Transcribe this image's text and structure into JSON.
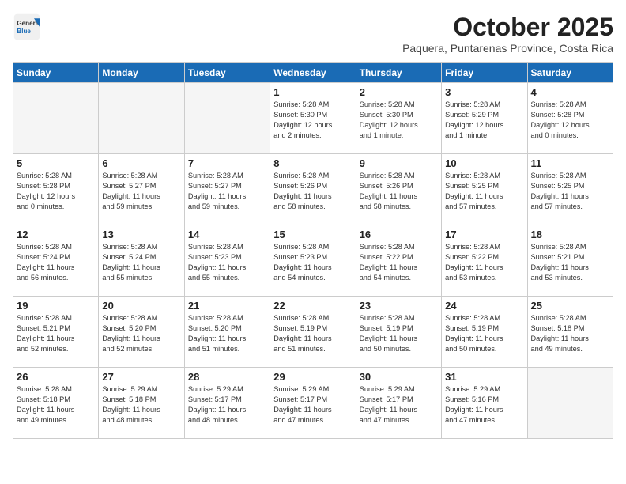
{
  "header": {
    "logo_general": "General",
    "logo_blue": "Blue",
    "month_title": "October 2025",
    "location": "Paquera, Puntarenas Province, Costa Rica"
  },
  "days_of_week": [
    "Sunday",
    "Monday",
    "Tuesday",
    "Wednesday",
    "Thursday",
    "Friday",
    "Saturday"
  ],
  "weeks": [
    [
      {
        "day": "",
        "info": ""
      },
      {
        "day": "",
        "info": ""
      },
      {
        "day": "",
        "info": ""
      },
      {
        "day": "1",
        "info": "Sunrise: 5:28 AM\nSunset: 5:30 PM\nDaylight: 12 hours\nand 2 minutes."
      },
      {
        "day": "2",
        "info": "Sunrise: 5:28 AM\nSunset: 5:30 PM\nDaylight: 12 hours\nand 1 minute."
      },
      {
        "day": "3",
        "info": "Sunrise: 5:28 AM\nSunset: 5:29 PM\nDaylight: 12 hours\nand 1 minute."
      },
      {
        "day": "4",
        "info": "Sunrise: 5:28 AM\nSunset: 5:28 PM\nDaylight: 12 hours\nand 0 minutes."
      }
    ],
    [
      {
        "day": "5",
        "info": "Sunrise: 5:28 AM\nSunset: 5:28 PM\nDaylight: 12 hours\nand 0 minutes."
      },
      {
        "day": "6",
        "info": "Sunrise: 5:28 AM\nSunset: 5:27 PM\nDaylight: 11 hours\nand 59 minutes."
      },
      {
        "day": "7",
        "info": "Sunrise: 5:28 AM\nSunset: 5:27 PM\nDaylight: 11 hours\nand 59 minutes."
      },
      {
        "day": "8",
        "info": "Sunrise: 5:28 AM\nSunset: 5:26 PM\nDaylight: 11 hours\nand 58 minutes."
      },
      {
        "day": "9",
        "info": "Sunrise: 5:28 AM\nSunset: 5:26 PM\nDaylight: 11 hours\nand 58 minutes."
      },
      {
        "day": "10",
        "info": "Sunrise: 5:28 AM\nSunset: 5:25 PM\nDaylight: 11 hours\nand 57 minutes."
      },
      {
        "day": "11",
        "info": "Sunrise: 5:28 AM\nSunset: 5:25 PM\nDaylight: 11 hours\nand 57 minutes."
      }
    ],
    [
      {
        "day": "12",
        "info": "Sunrise: 5:28 AM\nSunset: 5:24 PM\nDaylight: 11 hours\nand 56 minutes."
      },
      {
        "day": "13",
        "info": "Sunrise: 5:28 AM\nSunset: 5:24 PM\nDaylight: 11 hours\nand 55 minutes."
      },
      {
        "day": "14",
        "info": "Sunrise: 5:28 AM\nSunset: 5:23 PM\nDaylight: 11 hours\nand 55 minutes."
      },
      {
        "day": "15",
        "info": "Sunrise: 5:28 AM\nSunset: 5:23 PM\nDaylight: 11 hours\nand 54 minutes."
      },
      {
        "day": "16",
        "info": "Sunrise: 5:28 AM\nSunset: 5:22 PM\nDaylight: 11 hours\nand 54 minutes."
      },
      {
        "day": "17",
        "info": "Sunrise: 5:28 AM\nSunset: 5:22 PM\nDaylight: 11 hours\nand 53 minutes."
      },
      {
        "day": "18",
        "info": "Sunrise: 5:28 AM\nSunset: 5:21 PM\nDaylight: 11 hours\nand 53 minutes."
      }
    ],
    [
      {
        "day": "19",
        "info": "Sunrise: 5:28 AM\nSunset: 5:21 PM\nDaylight: 11 hours\nand 52 minutes."
      },
      {
        "day": "20",
        "info": "Sunrise: 5:28 AM\nSunset: 5:20 PM\nDaylight: 11 hours\nand 52 minutes."
      },
      {
        "day": "21",
        "info": "Sunrise: 5:28 AM\nSunset: 5:20 PM\nDaylight: 11 hours\nand 51 minutes."
      },
      {
        "day": "22",
        "info": "Sunrise: 5:28 AM\nSunset: 5:19 PM\nDaylight: 11 hours\nand 51 minutes."
      },
      {
        "day": "23",
        "info": "Sunrise: 5:28 AM\nSunset: 5:19 PM\nDaylight: 11 hours\nand 50 minutes."
      },
      {
        "day": "24",
        "info": "Sunrise: 5:28 AM\nSunset: 5:19 PM\nDaylight: 11 hours\nand 50 minutes."
      },
      {
        "day": "25",
        "info": "Sunrise: 5:28 AM\nSunset: 5:18 PM\nDaylight: 11 hours\nand 49 minutes."
      }
    ],
    [
      {
        "day": "26",
        "info": "Sunrise: 5:28 AM\nSunset: 5:18 PM\nDaylight: 11 hours\nand 49 minutes."
      },
      {
        "day": "27",
        "info": "Sunrise: 5:29 AM\nSunset: 5:18 PM\nDaylight: 11 hours\nand 48 minutes."
      },
      {
        "day": "28",
        "info": "Sunrise: 5:29 AM\nSunset: 5:17 PM\nDaylight: 11 hours\nand 48 minutes."
      },
      {
        "day": "29",
        "info": "Sunrise: 5:29 AM\nSunset: 5:17 PM\nDaylight: 11 hours\nand 47 minutes."
      },
      {
        "day": "30",
        "info": "Sunrise: 5:29 AM\nSunset: 5:17 PM\nDaylight: 11 hours\nand 47 minutes."
      },
      {
        "day": "31",
        "info": "Sunrise: 5:29 AM\nSunset: 5:16 PM\nDaylight: 11 hours\nand 47 minutes."
      },
      {
        "day": "",
        "info": ""
      }
    ]
  ]
}
